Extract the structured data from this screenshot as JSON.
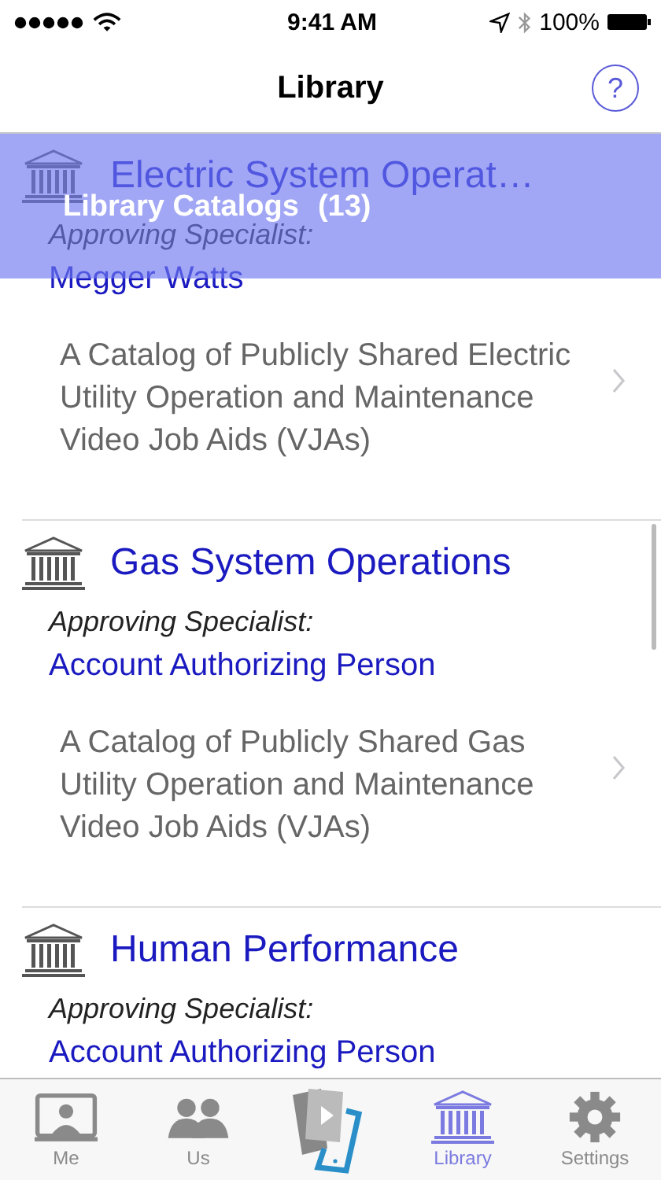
{
  "status_bar": {
    "time": "9:41 AM",
    "battery": "100%"
  },
  "nav": {
    "title": "Library",
    "help": "?"
  },
  "section_header": {
    "title": "Library Catalogs",
    "count": "(13)"
  },
  "catalogs": [
    {
      "title": "Electric System Operat…",
      "approver_label": "Approving Specialist:",
      "approver": "Megger Watts",
      "description": "A Catalog of Publicly Shared Electric Utility Operation and Maintenance Video Job Aids (VJAs)"
    },
    {
      "title": "Gas System Operations",
      "approver_label": "Approving Specialist:",
      "approver": "Account Authorizing Person",
      "description": "A Catalog of Publicly Shared Gas Utility Operation and Maintenance Video Job Aids (VJAs)"
    },
    {
      "title": "Human Performance",
      "approver_label": "Approving Specialist:",
      "approver": "Account Authorizing Person"
    }
  ],
  "tab_bar": [
    {
      "kind": "me",
      "label": "Me",
      "selected": false
    },
    {
      "kind": "us",
      "label": "Us",
      "selected": false
    },
    {
      "kind": "feature",
      "selected": false
    },
    {
      "kind": "library",
      "label": "Library",
      "selected": true
    },
    {
      "kind": "settings",
      "label": "Settings",
      "selected": false
    }
  ]
}
